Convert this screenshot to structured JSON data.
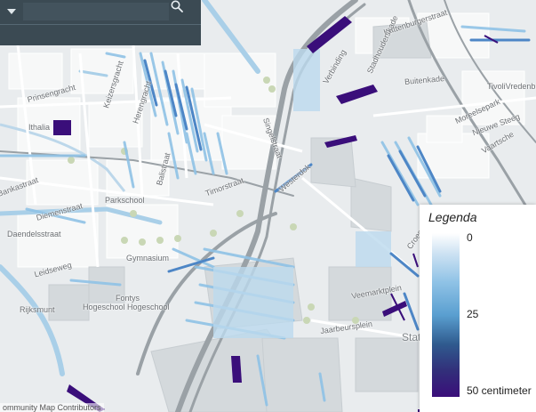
{
  "map": {
    "street_labels": [
      {
        "name": "label-kattenburgerstraat",
        "text": "Kattenburgerstraat"
      },
      {
        "name": "label-stadhouderskade",
        "text": "Stadhouderskade"
      },
      {
        "name": "label-timorstraat",
        "text": "Timorstraat"
      },
      {
        "name": "label-westerdok",
        "text": "Westerdok"
      },
      {
        "name": "label-singelstraat",
        "text": "Singelstraat"
      },
      {
        "name": "label-keizersgracht",
        "text": "Keizersgracht"
      },
      {
        "name": "label-herengracht",
        "text": "Herengracht"
      },
      {
        "name": "label-prinsengracht",
        "text": "Prinsengracht"
      },
      {
        "name": "label-verbinding",
        "text": "Verbinding"
      },
      {
        "name": "label-nieuwe-steeg",
        "text": "Nieuwe Steeg"
      },
      {
        "name": "label-buitenkade",
        "text": "Buitenkade"
      },
      {
        "name": "label-tivoli",
        "text": "TivoliVredenburg"
      },
      {
        "name": "label-moreelsepark",
        "text": "Moreelsepark"
      },
      {
        "name": "label-vaartsche",
        "text": "Vaartsche"
      },
      {
        "name": "label-croeselaan",
        "text": "Croeselaan"
      },
      {
        "name": "label-veemarktplein",
        "text": "Veemarktplein"
      },
      {
        "name": "label-jaarbeursplein",
        "text": "Jaarbeursplein"
      },
      {
        "name": "label-stat",
        "text": "Stat"
      },
      {
        "name": "label-rijksmunt",
        "text": "Rijksmunt"
      },
      {
        "name": "label-hogeschool",
        "text": "Hogeschool Hogeschool"
      },
      {
        "name": "label-fontys",
        "text": "Fontys"
      },
      {
        "name": "label-parkschool",
        "text": "Parkschool"
      },
      {
        "name": "label-gymnasium",
        "text": "Gymnasium"
      },
      {
        "name": "label-leidseweg",
        "text": "Leidseweg"
      },
      {
        "name": "label-daendelsstraat",
        "text": "Daendelsstraat"
      },
      {
        "name": "label-diemenstraat",
        "text": "Diemenstraat"
      },
      {
        "name": "label-bankastraat",
        "text": "Bankastraat"
      },
      {
        "name": "label-balistraat",
        "text": "Balistraat"
      },
      {
        "name": "label-thalia",
        "text": "Ithalia"
      }
    ]
  },
  "search": {
    "value": "",
    "placeholder": ""
  },
  "legend": {
    "title": "Legenda",
    "top_value": "0",
    "mid_value": "25",
    "bottom_value": "50 centimeter",
    "colors": {
      "low": "#ffffff",
      "mid": "#5a9fd0",
      "high": "#3a0e7a"
    }
  },
  "attribution": "ommunity Map Contributors",
  "colors": {
    "panel": "#3b4a53",
    "water": "#a9cfe8",
    "flood_low": "#8fc2e6",
    "flood_high": "#3a0e7a"
  }
}
